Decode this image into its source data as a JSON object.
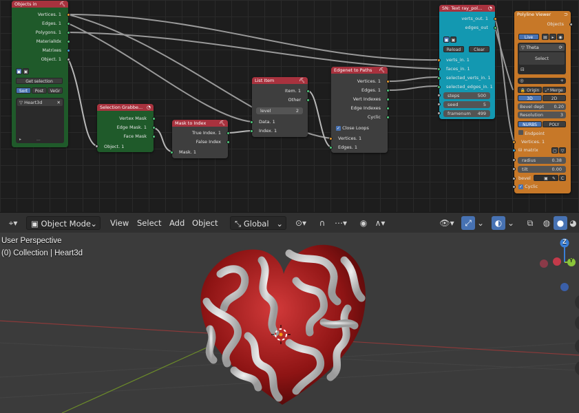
{
  "node_editor": {
    "objects_in": {
      "title": "Objects in",
      "outputs": [
        "Vertices. 1",
        "Edges. 1",
        "Polygons. 1",
        "MaterialIdx",
        "Matrixes",
        "Object. 1"
      ],
      "get_selection": "Get selection",
      "sort_buttons": [
        "Sort",
        "Post",
        "VeGr"
      ],
      "item": "Heart3d",
      "footer": "..."
    },
    "selection_grabber": {
      "title": "Selection Grabbe...",
      "outputs": [
        "Vertex Mask",
        "Edge Mask. 1",
        "Face Mask"
      ],
      "input": "Object. 1"
    },
    "mask_to_index": {
      "title": "Mask to Index",
      "outputs": [
        "True Index. 1",
        "False Index"
      ],
      "input": "Mask. 1"
    },
    "list_item": {
      "title": "List Item",
      "outputs": [
        "Item. 1",
        "Other"
      ],
      "level_label": "level",
      "level_value": "2",
      "inputs": [
        "Data. 1",
        "Index. 1"
      ]
    },
    "edgenet_to_paths": {
      "title": "Edgenet to Paths",
      "outputs": [
        "Vertices. 1",
        "Edges. 1",
        "Vert Indexes",
        "Edge Indexes",
        "Cyclic"
      ],
      "close_loops": "Close Loops",
      "inputs": [
        "Vertices. 1",
        "Edges. 1"
      ]
    },
    "sn_text": {
      "title": "SN: Text ray_pol...",
      "outputs": [
        "verts_out. 1",
        "edges_out"
      ],
      "reload": "Reload",
      "clear": "Clear",
      "inputs": [
        "verts_in. 1",
        "faces_in. 1",
        "selected_verts_in. 1",
        "selected_edges_in. 1"
      ],
      "params": [
        {
          "label": "steps",
          "value": "500"
        },
        {
          "label": "seed",
          "value": "5"
        },
        {
          "label": "framenum",
          "value": "499"
        }
      ]
    },
    "polyline_viewer": {
      "title": "Polyline Viewer",
      "output": "Objects",
      "live": "Live",
      "name": "Theta",
      "select": "Select",
      "origin": "Origin",
      "merge": "Merge",
      "mode_3d": "3D",
      "mode_2d": "2D",
      "bevel_depth_label": "Bevel dept",
      "bevel_depth_value": "0.20",
      "resolution_label": "Resolution",
      "resolution_value": "3",
      "nurbs": "NURBS",
      "poly": "POLY",
      "endpoint": "Endpoint",
      "inputs": [
        "Vertices. 1",
        "matrix"
      ],
      "radius_label": "radius",
      "radius_value": "0.38",
      "tilt_label": "tilt",
      "tilt_value": "0.00",
      "bevel_label": "bevel",
      "bevel_c": "C",
      "cyclic": "Cyclic"
    }
  },
  "viewport_header": {
    "mode": "Object Mode",
    "menus": [
      "View",
      "Select",
      "Add",
      "Object"
    ],
    "transform": "Global"
  },
  "viewport": {
    "perspective": "User Perspective",
    "collection": "(0) Collection | Heart3d",
    "gizmo_z": "Z",
    "gizmo_y": "Y"
  }
}
